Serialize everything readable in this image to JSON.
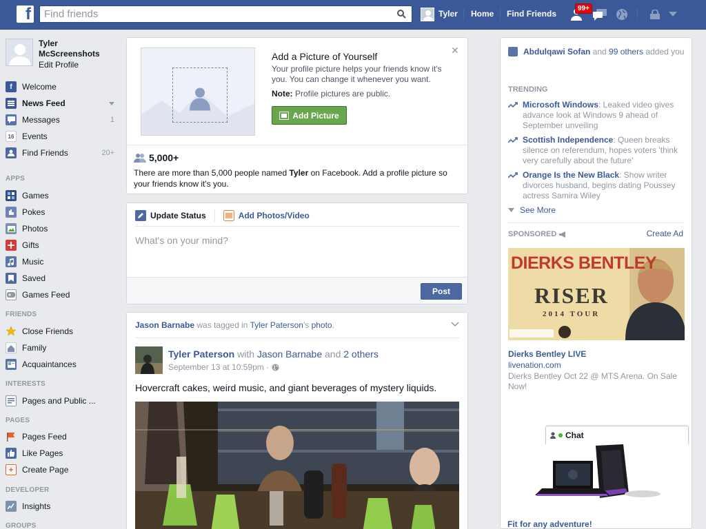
{
  "topbar": {
    "logo": "f",
    "search_placeholder": "Find friends",
    "user_name": "Tyler",
    "home": "Home",
    "find_friends": "Find Friends",
    "notification_count": "99+",
    "colors": {
      "bar": "#3b5998",
      "badge": "#dc0a0a"
    }
  },
  "leftnav": {
    "profile_name": "Tyler McScreenshots",
    "edit_profile": "Edit Profile",
    "favorites": [
      {
        "label": "Welcome",
        "count": "",
        "icon": "facebook-icon"
      },
      {
        "label": "News Feed",
        "count": "",
        "icon": "news-feed-icon"
      },
      {
        "label": "Messages",
        "count": "1",
        "icon": "messages-icon"
      },
      {
        "label": "Events",
        "count": "",
        "icon": "calendar-icon"
      },
      {
        "label": "Find Friends",
        "count": "20+",
        "icon": "find-friends-icon"
      }
    ],
    "apps_heading": "APPS",
    "apps": [
      {
        "label": "Games",
        "icon": "games-icon"
      },
      {
        "label": "Pokes",
        "icon": "pokes-icon"
      },
      {
        "label": "Photos",
        "icon": "photos-icon"
      },
      {
        "label": "Gifts",
        "icon": "gift-icon"
      },
      {
        "label": "Music",
        "icon": "music-icon"
      },
      {
        "label": "Saved",
        "icon": "bookmark-icon"
      },
      {
        "label": "Games Feed",
        "icon": "gamepad-icon"
      }
    ],
    "friends_heading": "FRIENDS",
    "friends": [
      {
        "label": "Close Friends",
        "icon": "star-icon"
      },
      {
        "label": "Family",
        "icon": "family-icon"
      },
      {
        "label": "Acquaintances",
        "icon": "acquaintances-icon"
      }
    ],
    "interests_heading": "INTERESTS",
    "interests": [
      {
        "label": "Pages and Public ...",
        "icon": "pages-public-icon"
      }
    ],
    "pages_heading": "PAGES",
    "pages": [
      {
        "label": "Pages Feed",
        "icon": "flag-icon"
      },
      {
        "label": "Like Pages",
        "icon": "like-icon"
      },
      {
        "label": "Create Page",
        "icon": "plus-icon"
      }
    ],
    "developer_heading": "DEVELOPER",
    "developer": [
      {
        "label": "Insights",
        "icon": "insights-icon"
      }
    ],
    "groups_heading": "GROUPS"
  },
  "profile_picture_card": {
    "title": "Add a Picture of Yourself",
    "description": "Your profile picture helps your friends know it's you. You can change it whenever you want.",
    "note_label": "Note:",
    "note_text": " Profile pictures are public.",
    "button": "Add Picture",
    "count": "5,000+",
    "count_desc_1": "There are more than 5,000 people named ",
    "count_desc_name": "Tyler",
    "count_desc_2": " on Facebook. Add a profile picture so your friends know it's you."
  },
  "composer": {
    "tab_status": "Update Status",
    "tab_photos": "Add Photos/Video",
    "placeholder": "What's on your mind?",
    "post": "Post"
  },
  "story": {
    "tagged_user": "Jason Barnabe",
    "tagged_text": " was tagged in ",
    "owner": "Tyler Paterson",
    "owner_suffix": "'s ",
    "photo_link": "photo",
    "period": ".",
    "author": "Tyler Paterson",
    "with": " with ",
    "with_user": "Jason Barnabe",
    "and": " and ",
    "others": "2 others",
    "time": "September 13 at 10:59pm ·",
    "text": "Hovercraft cakes, weird music, and giant beverages of mystery liquids."
  },
  "right": {
    "added_user": "Abdulqawi Sofan",
    "added_and": " and ",
    "added_others": "99 others",
    "added_suffix": " added you",
    "trending_heading": "TRENDING",
    "trending": [
      {
        "topic": "Microsoft Windows",
        "text": ": Leaked video gives advance look at Windows 9 ahead of September unveiling"
      },
      {
        "topic": "Scottish Independence",
        "text": ": Queen breaks silence on referendum, hopes voters 'think very carefully about the future'"
      },
      {
        "topic": "Orange Is the New Black",
        "text": ": Show writer divorces husband, begins dating Poussey actress Samira Wiley"
      }
    ],
    "see_more": "See More",
    "sponsored_heading": "SPONSORED",
    "create_ad": "Create Ad",
    "ad_banner_name": "DIERKS BENTLEY",
    "ad_banner_album": "RISER",
    "ad_banner_tour": "2014 TOUR",
    "ad_title": "Dierks Bentley LIVE",
    "ad_site": "livenation.com",
    "ad_desc": "Dierks Bentley Oct 22 @ MTS Arena. On Sale Now!",
    "ad2_title": "Fit for any adventure!"
  },
  "chat": {
    "label": "Chat"
  }
}
